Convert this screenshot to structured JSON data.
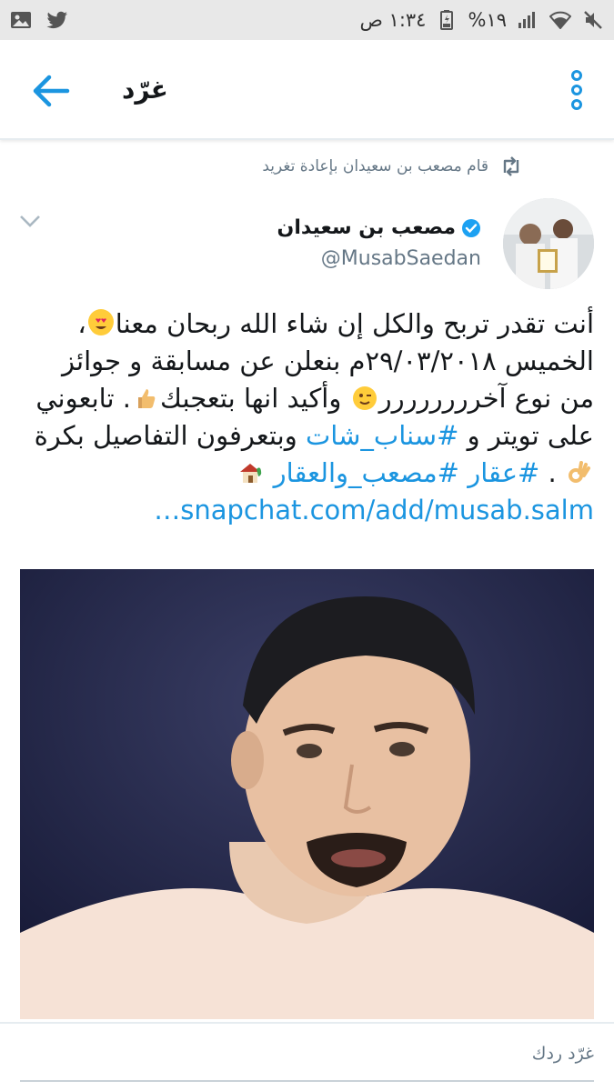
{
  "status_bar": {
    "time": "١:٣٤ ص",
    "battery_percent": "١٩%",
    "icons": [
      "image-icon",
      "twitter-bird-icon",
      "mute-icon",
      "wifi-icon",
      "signal-icon",
      "battery-icon"
    ]
  },
  "header": {
    "title": "غرّد",
    "back_icon": "arrow-left-icon",
    "more_icon": "more-vertical-icon"
  },
  "tweet": {
    "retweet_context": "قام مصعب بن سعيدان بإعادة تغريد",
    "author": {
      "name": "مصعب بن سعيدان",
      "handle": "@MusabSaedan",
      "verified": true
    },
    "text": {
      "line1": "أنت تقدر تربح والكل إن شاء الله ربحان معنا",
      "line2": "، الخميس ٢٩/٠٣/٢٠١٨م بنعلن عن مسابقة و جوائز من نوع آخرررررررر",
      "line3": " وأكيد انها بتعجبك",
      "line4": ". تابعوني على تويتر و ",
      "hashtag1": "#سناب_شات",
      "line5": " وبتعرفون التفاصيل بكرة",
      "line6": " . ",
      "hashtag2": "#عقار",
      "hashtag3": "#مصعب_والعقار",
      "link": "snapchat.com/add/musab.salm…"
    }
  },
  "reply": {
    "placeholder": "غرّد ردك"
  },
  "colors": {
    "accent": "#1b95e0",
    "secondary_text": "#657786",
    "retweet_green": "#657786"
  }
}
